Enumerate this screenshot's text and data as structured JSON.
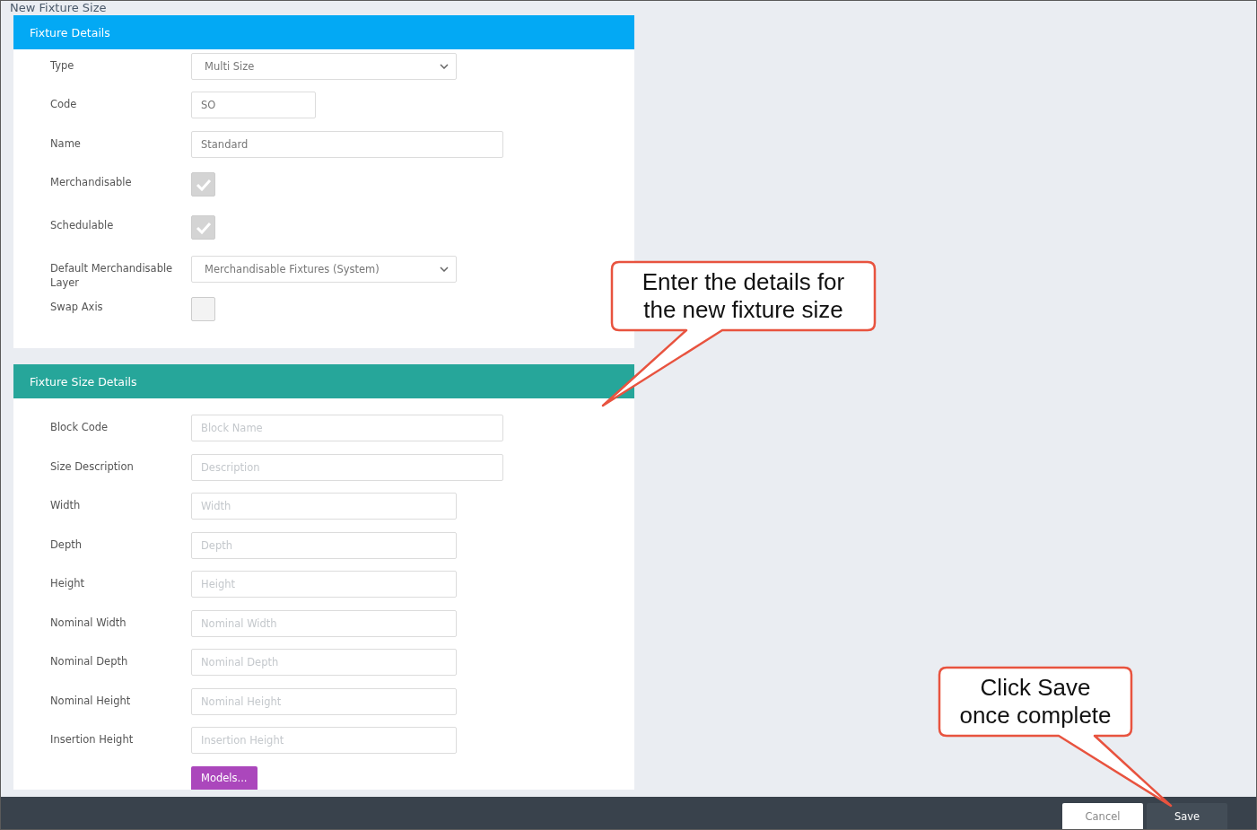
{
  "title": "New Fixture Size",
  "sections": [
    {
      "title": "Fixture Details",
      "color": "#03a9f4",
      "fields": [
        {
          "kind": "select",
          "label": "Type",
          "value": "Multi Size"
        },
        {
          "kind": "text",
          "label": "Code",
          "value": "SO"
        },
        {
          "kind": "text",
          "label": "Name",
          "value": "Standard"
        },
        {
          "kind": "checkbox",
          "label": "Merchandisable",
          "checked": true,
          "disabled": true
        },
        {
          "kind": "checkbox",
          "label": "Schedulable",
          "checked": true,
          "disabled": true
        },
        {
          "kind": "select",
          "label": "Default Merchandisable Layer",
          "value": "Merchandisable Fixtures (System)"
        },
        {
          "kind": "checkbox",
          "label": "Swap Axis",
          "checked": false,
          "disabled": true
        }
      ]
    },
    {
      "title": "Fixture Size Details",
      "color": "#26a69a",
      "fields": [
        {
          "kind": "text",
          "label": "Block Code",
          "placeholder": "Block Name"
        },
        {
          "kind": "text",
          "label": "Size Description",
          "placeholder": "Description"
        },
        {
          "kind": "text",
          "label": "Width",
          "placeholder": "Width"
        },
        {
          "kind": "text",
          "label": "Depth",
          "placeholder": "Depth"
        },
        {
          "kind": "text",
          "label": "Height",
          "placeholder": "Height"
        },
        {
          "kind": "text",
          "label": "Nominal Width",
          "placeholder": "Nominal Width"
        },
        {
          "kind": "text",
          "label": "Nominal Depth",
          "placeholder": "Nominal Depth"
        },
        {
          "kind": "text",
          "label": "Nominal Height",
          "placeholder": "Nominal Height"
        },
        {
          "kind": "text",
          "label": "Insertion Height",
          "placeholder": "Insertion Height"
        },
        {
          "kind": "button",
          "label": "Models..."
        }
      ]
    }
  ],
  "footer_buttons": [
    {
      "kind": "secondary",
      "label": "Cancel"
    },
    {
      "kind": "primary",
      "label": "Save"
    }
  ],
  "callouts": [
    "Enter the details for the new fixture size",
    "Click Save once complete"
  ]
}
